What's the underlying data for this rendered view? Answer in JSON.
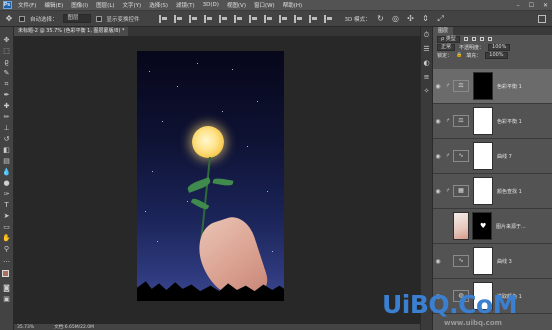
{
  "menubar": {
    "logo": "Ps",
    "items": [
      "文件(F)",
      "编辑(E)",
      "图像(I)",
      "图层(L)",
      "文字(Y)",
      "选择(S)",
      "滤镜(T)",
      "3D(D)",
      "视图(V)",
      "窗口(W)",
      "帮助(H)"
    ],
    "window_controls": [
      "–",
      "☐",
      "✕"
    ]
  },
  "optionsbar": {
    "auto_select_label": "自动选择：",
    "auto_select_value": "图层",
    "show_transform_label": "显示变换控件",
    "mode_3d_label": "3D 模式："
  },
  "document": {
    "tab_title": "未标题-2 @ 35.7% (色彩平衡 1, 图层蒙版/8) *"
  },
  "statusbar": {
    "zoom": "35.73%",
    "doc_info": "文档:6.65M/22.0M"
  },
  "layers_panel": {
    "tab_label": "图层",
    "filter_label": "ρ 类型",
    "blend_mode": "正常",
    "opacity_label": "不透明度：",
    "opacity_value": "100%",
    "lock_label": "锁定：",
    "fill_label": "填充：",
    "fill_value": "100%",
    "layers": [
      {
        "name": "色彩平衡 1",
        "type": "adjustment",
        "mask": "dark",
        "selected": true
      },
      {
        "name": "色彩平衡 1",
        "type": "adjustment",
        "mask": "light",
        "selected": false
      },
      {
        "name": "曲线 7",
        "type": "adjustment",
        "mask": "light",
        "selected": false
      },
      {
        "name": "颜色查找 1",
        "type": "adjustment",
        "mask": "light",
        "selected": false
      },
      {
        "name": "图片来源于...",
        "type": "photo",
        "mask": "dark",
        "selected": false
      },
      {
        "name": "曲线 3",
        "type": "adjustment",
        "mask": "light",
        "selected": false
      },
      {
        "name": "选取颜色 1",
        "type": "adjustment",
        "mask": "light",
        "selected": false
      }
    ]
  },
  "watermark": {
    "brand": "UiBQ.CoM",
    "url": "www.uibq.com"
  },
  "colors": {
    "foreground_swatch": "#ad6f5d",
    "background_swatch": "#f1f1f1",
    "panel_bg": "#535353",
    "canvas_bg": "#282828",
    "watermark": "#3b7fd0"
  }
}
